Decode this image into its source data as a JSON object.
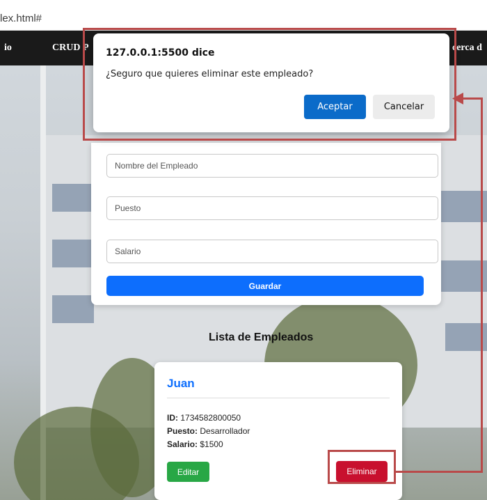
{
  "browser": {
    "url": "lex.html#"
  },
  "nav": {
    "items": [
      "io",
      "CRUD P",
      "cerca d"
    ]
  },
  "dialog": {
    "title": "127.0.0.1:5500 dice",
    "message": "¿Seguro que quieres eliminar este empleado?",
    "ok_label": "Aceptar",
    "cancel_label": "Cancelar"
  },
  "form": {
    "name_placeholder": "Nombre del Empleado",
    "position_placeholder": "Puesto",
    "salary_placeholder": "Salario",
    "save_label": "Guardar"
  },
  "list": {
    "title": "Lista de Empleados",
    "employee": {
      "name": "Juan",
      "id_label": "ID:",
      "id": "1734582800050",
      "position_label": "Puesto:",
      "position": "Desarrollador",
      "salary_label": "Salario:",
      "salary": "$1500",
      "edit_label": "Editar",
      "delete_label": "Eliminar"
    }
  },
  "colors": {
    "nav_bg": "#1a1a1a",
    "primary": "#0d6efd",
    "success": "#28a745",
    "danger": "#c8102e",
    "highlight": "#b94a4a"
  }
}
